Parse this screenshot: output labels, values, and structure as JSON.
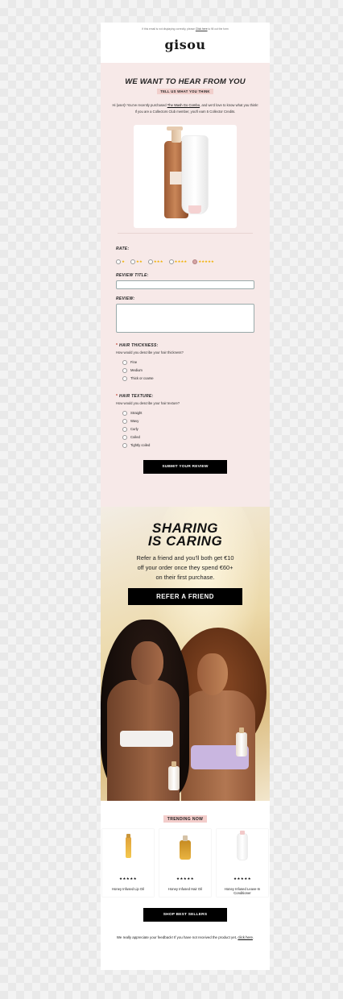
{
  "preheader": {
    "text_before": "If this email is not displaying correctly, please ",
    "link": "Click here",
    "text_after": " to fill out the form"
  },
  "brand": {
    "logo": "gisou"
  },
  "review": {
    "headline": "WE WANT TO HEAR FROM YOU",
    "pill": "TELL US WHAT YOU THINK",
    "intro_before": "Hi {user}! You've recently purchased ",
    "intro_product": "The Wash Go Combo",
    "intro_after": ", and we'd love to know what you think! If you are a Collectors Club member, you'll earn 5 Collector Credits.",
    "rate_label": "RATE:",
    "rating_options": [
      "★",
      "★★",
      "★★★",
      "★★★★",
      "★★★★★"
    ],
    "rating_selected": 5,
    "title_label": "REVIEW TITLE:",
    "review_label": "REVIEW:",
    "thickness": {
      "label": "HAIR THICKNESS:",
      "question": "How would you describe your hair thickness?",
      "options": [
        "Fine",
        "Medium",
        "Thick or coarse"
      ]
    },
    "texture": {
      "label": "HAIR TEXTURE:",
      "question": "How would you describe your hair texture?",
      "options": [
        "Straight",
        "Wavy",
        "Curly",
        "Coiled",
        "Tightly coiled"
      ]
    },
    "required_mark": "*",
    "submit": "SUBMIT YOUR REVIEW"
  },
  "referral": {
    "title_line1": "SHARING",
    "title_line2": "IS CARING",
    "text_line1": "Refer a friend and you'll both get €10",
    "text_line2": "off your order once they spend €60+",
    "text_line3": "on their first purchase.",
    "button": "REFER A FRIEND"
  },
  "trending": {
    "pill": "TRENDING NOW",
    "products": [
      {
        "name": "Honey Infused Lip Oil",
        "stars": "★★★★★"
      },
      {
        "name": "Honey Infused Hair Oil",
        "stars": "★★★★★"
      },
      {
        "name": "Honey Infused Leave-In Conditioner",
        "stars": "★★★★★"
      }
    ],
    "button": "SHOP BEST SELLERS"
  },
  "footer": {
    "text": "We really appreciate your feedback! If you have not received the product yet, ",
    "link": "click here",
    "end": "."
  }
}
